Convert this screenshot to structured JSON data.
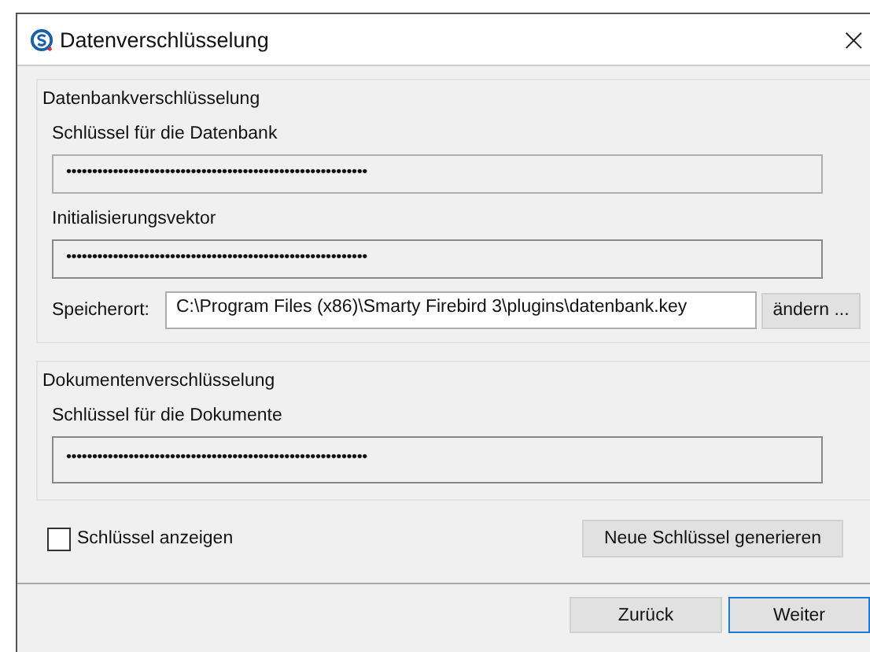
{
  "window": {
    "title": "Datenverschlüsselung",
    "close": "×"
  },
  "database_group": {
    "title": "Datenbankverschlüsselung",
    "fields": [
      {
        "label": "Schlüssel für die Datenbank",
        "value": "••••••••••••••••••••••••••••••••••••••••••••••••••••••••••"
      },
      {
        "label": "Initialisierungsvektor",
        "value": "••••••••••••••••••••••••••••••••••••••••••••••••••••••••••"
      }
    ],
    "location": {
      "label": "Speicherort:",
      "value": "C:\\Program Files (x86)\\Smarty Firebird 3\\plugins\\datenbank.key",
      "button": "ändern ..."
    }
  },
  "document_group": {
    "title": "Dokumentenverschlüsselung",
    "fields": [
      {
        "label": "Schlüssel für die Dokumente",
        "value": "••••••••••••••••••••••••••••••••••••••••••••••••••••••••••"
      }
    ]
  },
  "show_keys": {
    "label": "Schlüssel anzeigen",
    "checked": false
  },
  "generate_button": "Neue Schlüssel generieren",
  "buttons": [
    {
      "label": "Zurück",
      "default": false
    },
    {
      "label": "Weiter",
      "default": true
    }
  ]
}
